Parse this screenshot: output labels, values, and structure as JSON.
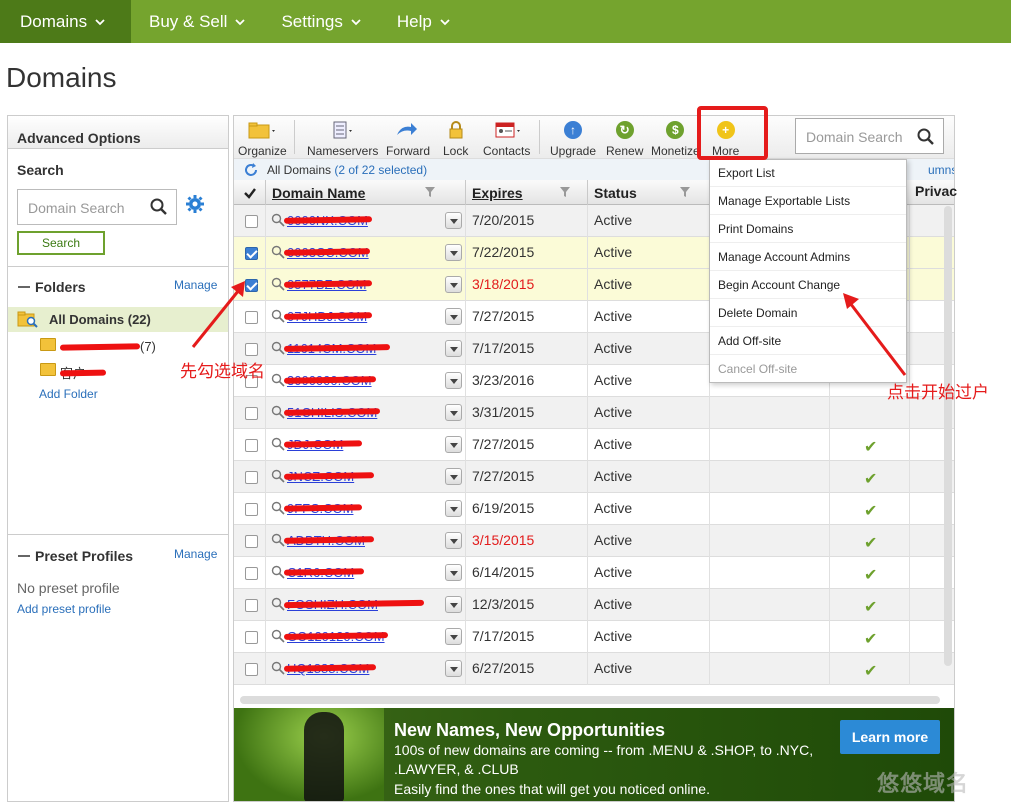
{
  "nav": {
    "items": [
      {
        "label": "Domains"
      },
      {
        "label": "Buy & Sell"
      },
      {
        "label": "Settings"
      },
      {
        "label": "Help"
      }
    ]
  },
  "page_title": "Domains",
  "sidebar": {
    "advanced_options": "Advanced Options",
    "search_label": "Search",
    "search_placeholder": "Domain Search",
    "search_button": "Search",
    "folders_title": "Folders",
    "folders_manage": "Manage",
    "all_domains": "All Domains (22)",
    "folder1_suffix": "(7)",
    "folder1_visible": "...",
    "folder2_visible": "客户",
    "add_folder": "Add Folder",
    "preset_title": "Preset Profiles",
    "preset_manage": "Manage",
    "no_preset": "No preset profile",
    "add_preset": "Add preset profile"
  },
  "toolbar": {
    "organize": "Organize",
    "nameservers": "Nameservers",
    "forward": "Forward",
    "lock": "Lock",
    "contacts": "Contacts",
    "upgrade": "Upgrade",
    "renew": "Renew",
    "monetize": "Monetize",
    "more": "More",
    "search_placeholder": "Domain Search"
  },
  "list": {
    "all_domains": "All Domains",
    "selection": "(2 of 22 selected)",
    "columns_link": "umns",
    "headers": {
      "domain_name": "Domain Name",
      "expires": "Expires",
      "status": "Status",
      "privacy": "Privac"
    },
    "rows": [
      {
        "domain": "0000NX.COM",
        "expires": "7/20/2015",
        "status": "Active",
        "checked": false,
        "red": false
      },
      {
        "domain": "0003CC.COM",
        "expires": "7/22/2015",
        "status": "Active",
        "checked": true,
        "red": false
      },
      {
        "domain": "0577BZ.COM",
        "expires": "3/18/2015",
        "status": "Active",
        "checked": true,
        "red": true
      },
      {
        "domain": "07JHDJ.COM",
        "expires": "7/27/2015",
        "status": "Active",
        "checked": false,
        "red": false
      },
      {
        "domain": "11614CM.COM",
        "expires": "7/17/2015",
        "status": "Active",
        "checked": false,
        "red": false
      },
      {
        "domain": "3000000.COM",
        "expires": "3/23/2016",
        "status": "Active",
        "checked": false,
        "red": false
      },
      {
        "domain": "51CHILIS.COM",
        "expires": "3/31/2015",
        "status": "Active",
        "checked": false,
        "red": false
      },
      {
        "domain": "JDJ.COM",
        "expires": "7/27/2015",
        "status": "Active",
        "checked": false,
        "red": false
      },
      {
        "domain": "JNCZ.COM",
        "expires": "7/27/2015",
        "status": "Active",
        "checked": false,
        "red": false
      },
      {
        "domain": "9FFC.COM",
        "expires": "6/19/2015",
        "status": "Active",
        "checked": false,
        "red": false
      },
      {
        "domain": "ADBTH.COM",
        "expires": "3/15/2015",
        "status": "Active",
        "checked": false,
        "red": true
      },
      {
        "domain": "C1R6.COM",
        "expires": "6/14/2015",
        "status": "Active",
        "checked": false,
        "red": false
      },
      {
        "domain": "FOSHIZH.COM",
        "expires": "12/3/2015",
        "status": "Active",
        "checked": false,
        "red": false
      },
      {
        "domain": "GO120120.COM",
        "expires": "7/17/2015",
        "status": "Active",
        "checked": false,
        "red": false
      },
      {
        "domain": "HQ1888.COM",
        "expires": "6/27/2015",
        "status": "Active",
        "checked": false,
        "red": false
      }
    ]
  },
  "more_menu": {
    "items": [
      {
        "label": "Export List",
        "disabled": false
      },
      {
        "label": "Manage Exportable Lists",
        "disabled": false
      },
      {
        "label": "Print Domains",
        "disabled": false
      },
      {
        "label": "Manage Account Admins",
        "disabled": false
      },
      {
        "label": "Begin Account Change",
        "disabled": false
      },
      {
        "label": "Delete Domain",
        "disabled": false
      },
      {
        "label": "Add Off-site",
        "disabled": false
      },
      {
        "label": "Cancel Off-site",
        "disabled": true
      }
    ]
  },
  "banner": {
    "title": "New Names, New Opportunities",
    "line1": "100s of new domains are coming -- from .MENU & .SHOP, to .NYC,",
    "line2": ".LAWYER, & .CLUB",
    "line3": "Easily find the ones that will get you noticed online.",
    "button": "Learn more"
  },
  "annotations": {
    "select_domain": "先勾选域名",
    "begin_transfer": "点击开始过户"
  },
  "watermark": "悠悠域名",
  "colors": {
    "nav_green": "#75a42e",
    "nav_active": "#4d7a18",
    "link_blue": "#2a6fba",
    "domain_blue": "#2a3fd8",
    "expired_red": "#e21b1b",
    "annotation_red": "#e51b1b",
    "check_green": "#6ea12e"
  }
}
